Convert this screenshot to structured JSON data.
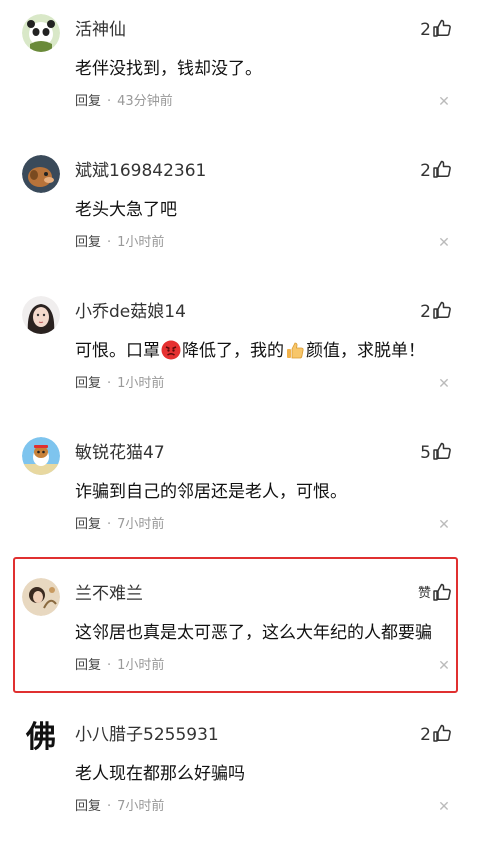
{
  "comments": [
    {
      "username": "活神仙",
      "text": "老伴没找到，钱却没了。",
      "likes": "2",
      "reply_label": "回复",
      "time": "43分钟前"
    },
    {
      "username": "斌斌169842361",
      "text": "老头大急了吧",
      "likes": "2",
      "reply_label": "回复",
      "time": "1小时前"
    },
    {
      "username": "小乔de菇娘14",
      "text_parts": [
        "可恨。口罩",
        "降低了，我的",
        "颜值，求脱单！"
      ],
      "likes": "2",
      "reply_label": "回复",
      "time": "1小时前"
    },
    {
      "username": "敏锐花猫47",
      "text": "诈骗到自己的邻居还是老人，可恨。",
      "likes": "5",
      "reply_label": "回复",
      "time": "7小时前"
    },
    {
      "username": "兰不难兰",
      "text": "这邻居也真是太可恶了，这么大年纪的人都要骗",
      "likes": "赞",
      "reply_label": "回复",
      "time": "1小时前"
    },
    {
      "username": "小八腊子5255931",
      "text": "老人现在都那么好骗吗",
      "likes": "2",
      "reply_label": "回复",
      "time": "7小时前"
    }
  ],
  "separator": "·",
  "avatar6_glyph": "佛",
  "highlight_color": "#e03030"
}
